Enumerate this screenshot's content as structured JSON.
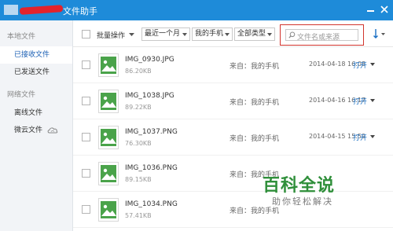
{
  "window": {
    "title": "文件助手"
  },
  "sidebar": {
    "sections": [
      {
        "label": "本地文件",
        "items": [
          {
            "label": "已接收文件",
            "active": true
          },
          {
            "label": "已发送文件",
            "active": false
          }
        ]
      },
      {
        "label": "网络文件",
        "items": [
          {
            "label": "离线文件",
            "active": false
          },
          {
            "label": "微云文件",
            "active": false,
            "icon": "cloud-icon"
          }
        ]
      }
    ]
  },
  "toolbar": {
    "batch_label": "批量操作",
    "time_filter": "最近一个月",
    "source_filter": "我的手机",
    "type_filter": "全部类型",
    "search_placeholder": "文件名或来源"
  },
  "files": [
    {
      "name": "IMG_0930.JPG",
      "size": "86.20KB",
      "source": "来自：我的手机",
      "date": "2014-04-18 16:08",
      "action": "打开"
    },
    {
      "name": "IMG_1038.JPG",
      "size": "89.22KB",
      "source": "来自：我的手机",
      "date": "2014-04-16 16:17",
      "action": "打开"
    },
    {
      "name": "IMG_1037.PNG",
      "size": "76.30KB",
      "source": "来自：我的手机",
      "date": "2014-04-15 15:59",
      "action": "打开"
    },
    {
      "name": "IMG_1036.PNG",
      "size": "89.15KB",
      "source": "来自：我的手机",
      "date": "",
      "action": ""
    },
    {
      "name": "IMG_1034.PNG",
      "size": "57.41KB",
      "source": "来自：我的手机",
      "date": "",
      "action": ""
    }
  ],
  "watermark": {
    "brand": "百科全说",
    "tagline": "助你轻松解决"
  },
  "colors": {
    "titlebar": "#1e8bd9",
    "accent_link": "#1a6fc4",
    "highlight_box": "#d2342d",
    "watermark_green": "#2f8f3a"
  }
}
